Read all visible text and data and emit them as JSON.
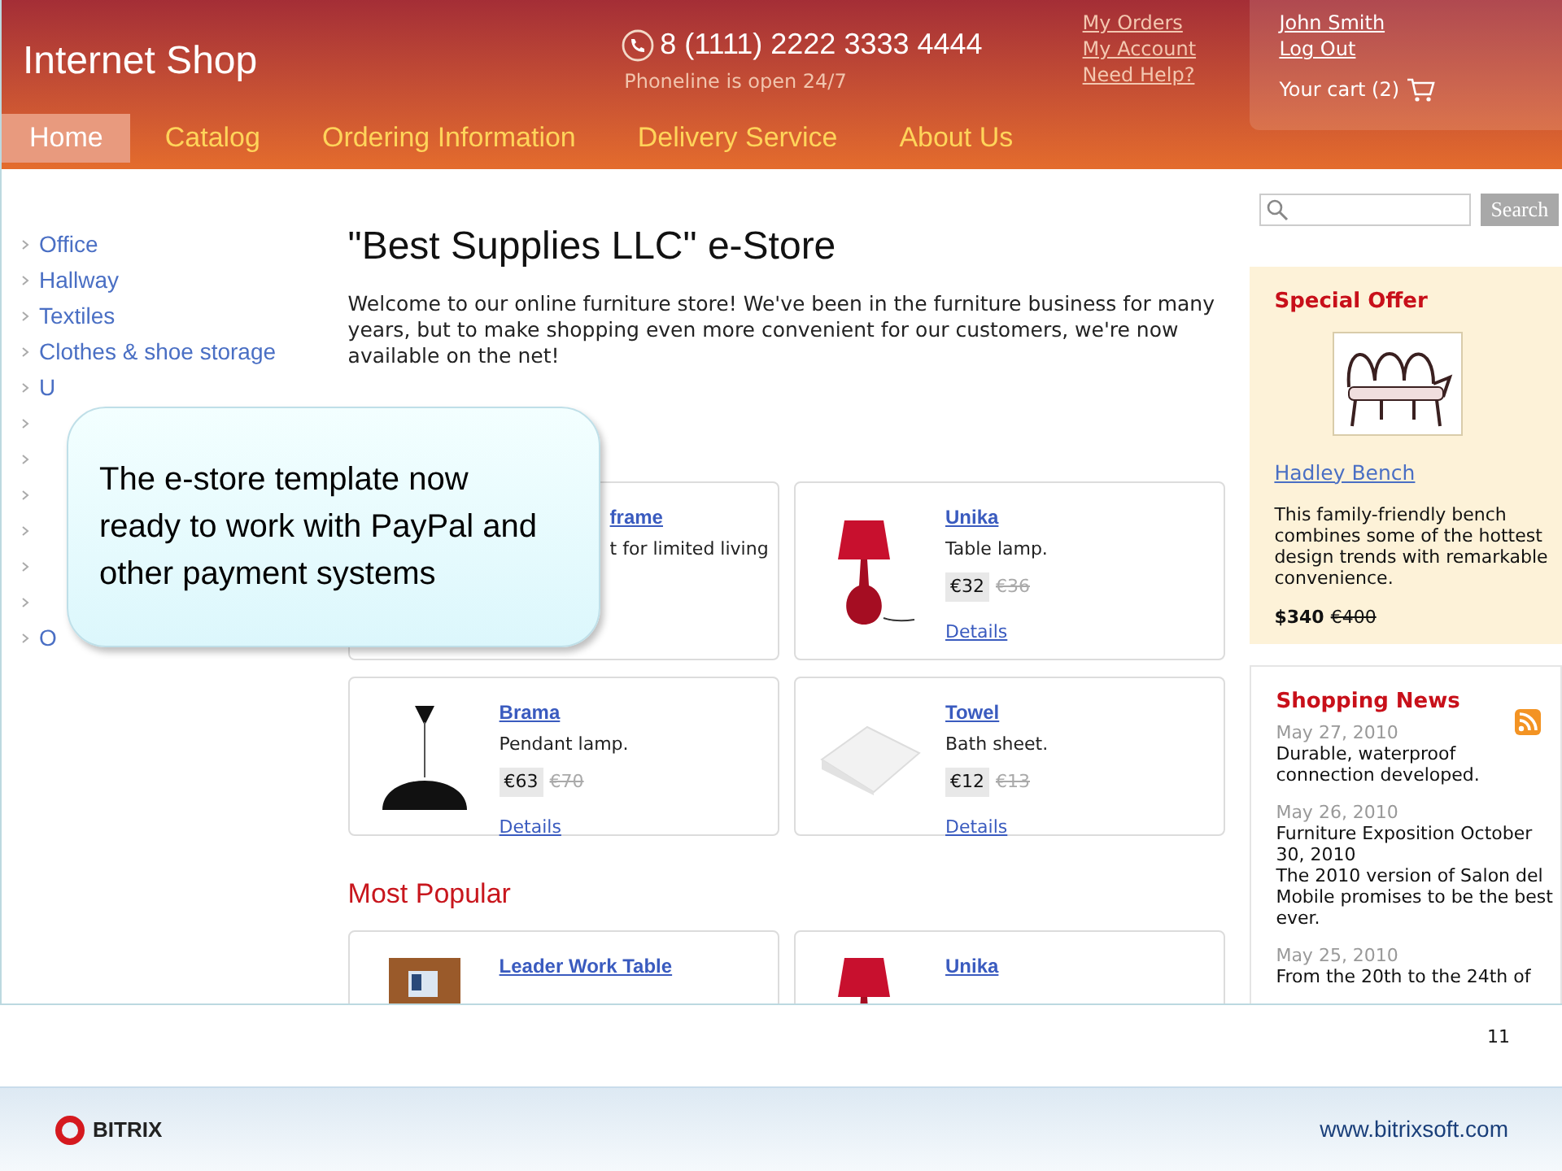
{
  "header": {
    "shop_name": "Internet Shop",
    "phone": "8 (1111) 2222 3333 4444",
    "phone_note": "Phoneline is open 24/7",
    "links": [
      "My Orders",
      "My Account",
      "Need Help?"
    ],
    "user": {
      "name": "John Smith",
      "logout": "Log Out",
      "cart": "Your cart (2)"
    }
  },
  "nav": [
    {
      "label": "Home",
      "selected": true
    },
    {
      "label": "Catalog",
      "selected": false
    },
    {
      "label": "Ordering Information",
      "selected": false
    },
    {
      "label": "Delivery Service",
      "selected": false
    },
    {
      "label": "About Us",
      "selected": false
    }
  ],
  "sidebar": {
    "items": [
      {
        "kind": "link",
        "label": "Office"
      },
      {
        "kind": "link",
        "label": "Hallway"
      },
      {
        "kind": "link",
        "label": "Textiles"
      },
      {
        "kind": "link",
        "label": "Clothes & shoe storage"
      },
      {
        "kind": "link",
        "label": "U"
      },
      {
        "kind": "covered"
      },
      {
        "kind": "covered"
      },
      {
        "kind": "covered"
      },
      {
        "kind": "covered"
      },
      {
        "kind": "covered"
      },
      {
        "kind": "covered"
      },
      {
        "kind": "link",
        "label": "O"
      }
    ]
  },
  "main": {
    "title": "\"Best Supplies LLC\" e-Store",
    "intro": "Welcome to our online furniture store! We've been in the furniture business for many years, but to make shopping even more convenient for our customers, we're now available on the net!",
    "products": [
      {
        "kind": "covered",
        "title": "frame",
        "description": "t for limited living"
      },
      {
        "kind": "table-lamp",
        "title": "Unika",
        "description": "Table lamp.",
        "price": "€32",
        "old_price": "€36",
        "details": "Details"
      },
      {
        "kind": "pendant-lamp",
        "title": "Brama",
        "description": "Pendant lamp.",
        "price": "€63",
        "old_price": "€70",
        "details": "Details"
      },
      {
        "kind": "towel",
        "title": "Towel",
        "description": "Bath sheet.",
        "price": "€12",
        "old_price": "€13",
        "details": "Details"
      }
    ],
    "popular_title": "Most Popular",
    "popular": [
      {
        "kind": "work-table",
        "title": "Leader Work Table"
      },
      {
        "kind": "table-lamp",
        "title": "Unika"
      }
    ]
  },
  "search": {
    "button": "Search"
  },
  "special_offer": {
    "title": "Special Offer",
    "name": "Hadley Bench",
    "description": "This family-friendly bench combines some of the hottest design trends with remarkable convenience.",
    "price": "$340",
    "old_price": "€400"
  },
  "news": {
    "title": "Shopping News",
    "items": [
      {
        "date": "May 27, 2010",
        "text": "Durable, waterproof connection developed."
      },
      {
        "date": "May 26, 2010",
        "text": "Furniture Exposition October 30, 2010",
        "body": "The 2010 version of Salon del Mobile promises to be the best ever."
      },
      {
        "date": "May 25, 2010",
        "text": "From the 20th to the 24th of"
      }
    ]
  },
  "callout": "The e-store template now ready to work with PayPal and other payment systems",
  "slide": {
    "page_number": "11",
    "logo": "BITRIX",
    "url": "www.bitrixsoft.com"
  }
}
